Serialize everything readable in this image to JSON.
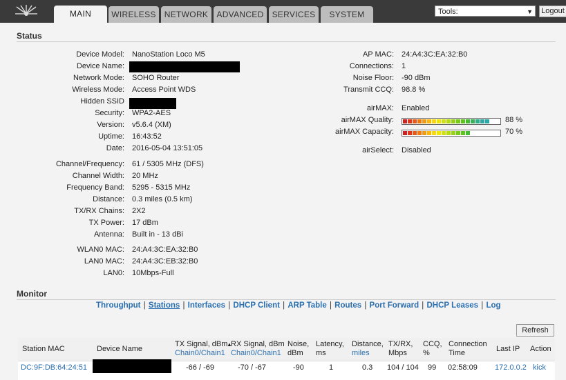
{
  "tabs": [
    {
      "label": "MAIN",
      "active": true
    },
    {
      "label": "WIRELESS"
    },
    {
      "label": "NETWORK"
    },
    {
      "label": "ADVANCED"
    },
    {
      "label": "SERVICES"
    },
    {
      "label": "SYSTEM"
    }
  ],
  "tools": {
    "selected": "Tools:"
  },
  "logout_label": "Logout",
  "status": {
    "title": "Status",
    "left": [
      {
        "label": "Device Model:",
        "value": "NanoStation Loco M5"
      },
      {
        "label": "Device Name:",
        "value": ""
      },
      {
        "label": "Network Mode:",
        "value": "SOHO Router"
      },
      {
        "label": "Wireless Mode:",
        "value": "Access Point WDS"
      },
      {
        "label": "Hidden SSID",
        "value": ""
      },
      {
        "label": "Security:",
        "value": "WPA2-AES"
      },
      {
        "label": "Version:",
        "value": "v5.6.4 (XM)"
      },
      {
        "label": "Uptime:",
        "value": "16:43:52"
      },
      {
        "label": "Date:",
        "value": "2016-05-04 13:51:05"
      },
      {
        "label": "Channel/Frequency:",
        "value": "61 / 5305 MHz (DFS)"
      },
      {
        "label": "Channel Width:",
        "value": "20 MHz"
      },
      {
        "label": "Frequency Band:",
        "value": "5295 - 5315 MHz"
      },
      {
        "label": "Distance:",
        "value": "0.3 miles (0.5 km)"
      },
      {
        "label": "TX/RX Chains:",
        "value": "2X2"
      },
      {
        "label": "TX Power:",
        "value": "17 dBm"
      },
      {
        "label": "Antenna:",
        "value": "Built in - 13 dBi"
      },
      {
        "label": "WLAN0 MAC:",
        "value": "24:A4:3C:EA:32:B0"
      },
      {
        "label": "LAN0 MAC:",
        "value": "24:A4:3C:EB:32:B0"
      },
      {
        "label": "LAN0:",
        "value": "10Mbps-Full"
      }
    ],
    "right": [
      {
        "label": "AP MAC:",
        "value": "24:A4:3C:EA:32:B0"
      },
      {
        "label": "Connections:",
        "value": "1"
      },
      {
        "label": "Noise Floor:",
        "value": "-90 dBm"
      },
      {
        "label": "Transmit CCQ:",
        "value": "98.8 %"
      },
      {
        "label": "airMAX:",
        "value": "Enabled"
      },
      {
        "label": "airMAX Quality:",
        "value": "88 %",
        "level": 0.88
      },
      {
        "label": "airMAX Capacity:",
        "value": "70 %",
        "level": 0.7
      },
      {
        "label": "airSelect:",
        "value": "Disabled"
      }
    ]
  },
  "monitor": {
    "title": "Monitor",
    "links": [
      "Throughput",
      "Stations",
      "Interfaces",
      "DHCP Client",
      "ARP Table",
      "Routes",
      "Port Forward",
      "DHCP Leases",
      "Log"
    ],
    "selected_link": "Stations",
    "refresh_label": "Refresh",
    "columns": [
      {
        "label": "Station MAC"
      },
      {
        "label": "Device Name"
      },
      {
        "label": "TX Signal, dBm",
        "sub": "Chain0/Chain1"
      },
      {
        "label": "RX Signal, dBm",
        "sub": "Chain0/Chain1"
      },
      {
        "label": "Noise,",
        "sub2": "dBm"
      },
      {
        "label": "Latency,",
        "sub2": "ms"
      },
      {
        "label": "Distance,",
        "sub": "miles"
      },
      {
        "label": "TX/RX,",
        "sub2": "Mbps"
      },
      {
        "label": "CCQ,",
        "sub2": "%"
      },
      {
        "label": "Connection",
        "sub2": "Time"
      },
      {
        "label": "Last IP"
      },
      {
        "label": "Action"
      }
    ],
    "rows": [
      {
        "mac": "DC:9F:DB:64:24:51",
        "device_name": "",
        "tx_signal": "-66 / -69",
        "rx_signal": "-70 / -67",
        "noise": "-90",
        "latency": "1",
        "distance": "0.3",
        "txrx": "104 / 104",
        "ccq": "99",
        "conn_time": "02:58:09",
        "last_ip": "172.0.0.2",
        "action": "kick"
      }
    ]
  }
}
